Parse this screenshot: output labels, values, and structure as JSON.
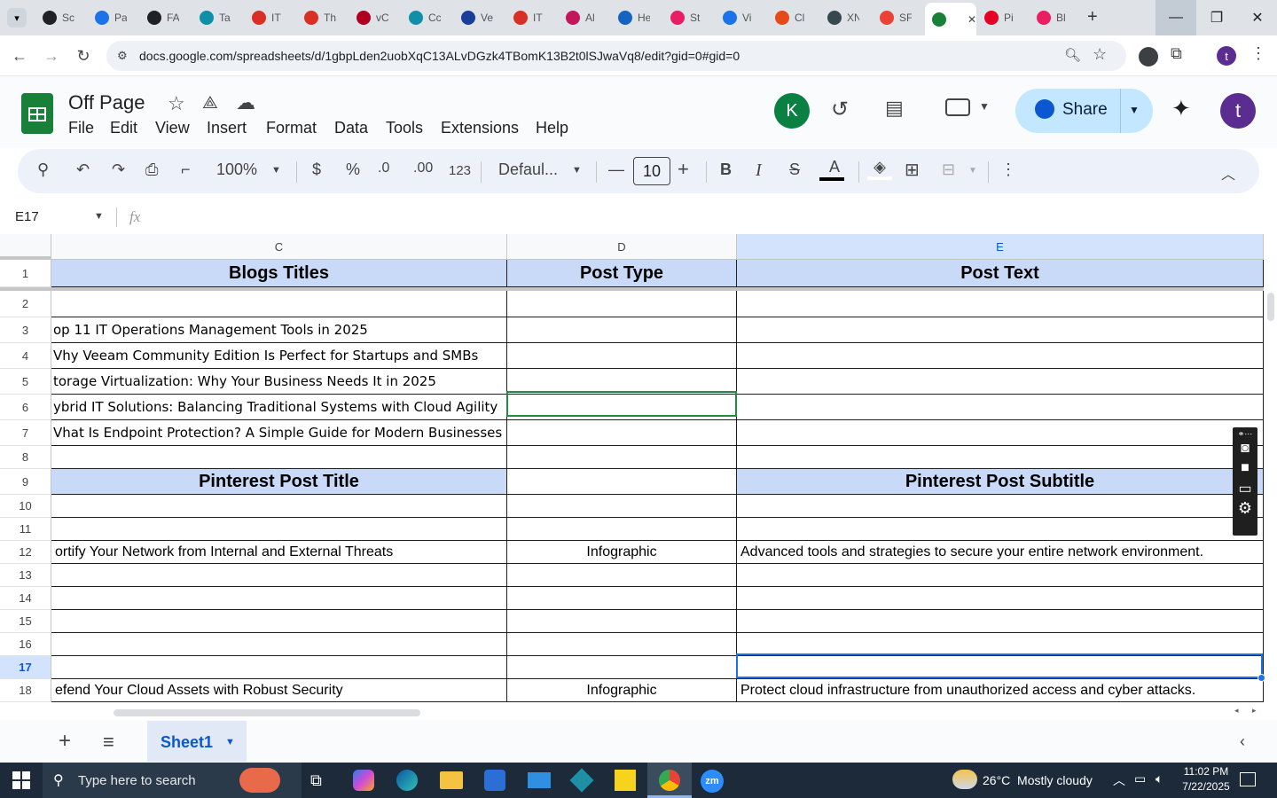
{
  "browser": {
    "tabs": [
      {
        "label": "Sc",
        "color": "#202124"
      },
      {
        "label": "Pa",
        "color": "#1a73e8"
      },
      {
        "label": "FA",
        "color": "#202124"
      },
      {
        "label": "Ta",
        "color": "#0f8fa8"
      },
      {
        "label": "IT",
        "color": "#d93025"
      },
      {
        "label": "Th",
        "color": "#d93025"
      },
      {
        "label": "vC",
        "color": "#b00020"
      },
      {
        "label": "Cc",
        "color": "#0f8fa8"
      },
      {
        "label": "Ve",
        "color": "#1a3d9a"
      },
      {
        "label": "IT",
        "color": "#d93025"
      },
      {
        "label": "Al",
        "color": "#c2185b"
      },
      {
        "label": "He",
        "color": "#1565c0"
      },
      {
        "label": "St",
        "color": "#e91e63"
      },
      {
        "label": "Vi",
        "color": "#1a73e8"
      },
      {
        "label": "Cl",
        "color": "#e64a19"
      },
      {
        "label": "XN",
        "color": "#37474f"
      },
      {
        "label": "SF",
        "color": "#ea4335"
      },
      {
        "label": "",
        "color": "#188038",
        "active": true
      },
      {
        "label": "Pi",
        "color": "#e60023"
      },
      {
        "label": "Bl",
        "color": "#e91e63"
      }
    ],
    "url": "docs.google.com/spreadsheets/d/1gbpLden2uobXqC13ALvDGzk4TBomK13B2t0lSJwaVq8/edit?gid=0#gid=0",
    "new_tab": "+",
    "profile_initial": "t"
  },
  "app": {
    "title": "Off Page",
    "menus": [
      "File",
      "Edit",
      "View",
      "Insert",
      "Format",
      "Data",
      "Tools",
      "Extensions",
      "Help"
    ],
    "share_label": "Share",
    "avatar_k": "K",
    "avatar_t": "t"
  },
  "toolbar": {
    "zoom": "100%",
    "currency": "$",
    "percent": "%",
    "dec_decrease": ".0",
    "dec_increase": ".00",
    "number_format": "123",
    "font": "Defaul...",
    "font_size": "10",
    "bold": "B",
    "italic": "I",
    "text_color": "A"
  },
  "formula": {
    "name_box": "E17",
    "fx": "fx",
    "value": ""
  },
  "grid": {
    "columns": [
      "C",
      "D",
      "E"
    ],
    "rows": [
      {
        "n": "1",
        "c": "Blogs Titles",
        "d": "Post Type",
        "e": "Post Text",
        "header": true
      },
      {
        "n": "2",
        "c": "",
        "d": "",
        "e": ""
      },
      {
        "n": "3",
        "c": "op 11 IT Operations Management Tools in 2025",
        "d": "",
        "e": ""
      },
      {
        "n": "4",
        "c": "Vhy Veeam Community Edition Is Perfect for Startups and SMBs",
        "d": "",
        "e": ""
      },
      {
        "n": "5",
        "c": "torage Virtualization: Why Your Business Needs It in 2025",
        "d": "",
        "e": ""
      },
      {
        "n": "6",
        "c": "ybrid IT Solutions: Balancing Traditional Systems with Cloud Agility",
        "d": "",
        "e": ""
      },
      {
        "n": "7",
        "c": "Vhat Is Endpoint Protection? A Simple Guide for Modern Businesses",
        "d": "",
        "e": ""
      },
      {
        "n": "8",
        "c": "",
        "d": "",
        "e": ""
      },
      {
        "n": "9",
        "c": "Pinterest Post Title",
        "d": "",
        "e": "Pinterest Post Subtitle",
        "header": true
      },
      {
        "n": "10",
        "c": "",
        "d": "",
        "e": ""
      },
      {
        "n": "11",
        "c": "",
        "d": "",
        "e": ""
      },
      {
        "n": "12",
        "c": "ortify Your Network from Internal and External Threats",
        "d": "Infographic",
        "e": "Advanced tools and strategies to secure your entire network environment."
      },
      {
        "n": "13",
        "c": "",
        "d": "",
        "e": ""
      },
      {
        "n": "14",
        "c": "",
        "d": "",
        "e": ""
      },
      {
        "n": "15",
        "c": "",
        "d": "",
        "e": ""
      },
      {
        "n": "16",
        "c": "",
        "d": "",
        "e": ""
      },
      {
        "n": "17",
        "c": "",
        "d": "",
        "e": "",
        "selected": true
      },
      {
        "n": "18",
        "c": "efend Your Cloud Assets with Robust Security",
        "d": "Infographic",
        "e": "Protect cloud infrastructure from unauthorized access and cyber attacks."
      }
    ]
  },
  "sheets": {
    "add": "+",
    "active": "Sheet1"
  },
  "taskbar": {
    "search_placeholder": "Type here to search",
    "weather": "26°C  Mostly cloudy",
    "time": "11:02 PM",
    "date": "7/22/2025"
  },
  "colors": {
    "header_fill": "#c9daf8",
    "accent": "#0b57d0",
    "sheets_green": "#188038"
  }
}
